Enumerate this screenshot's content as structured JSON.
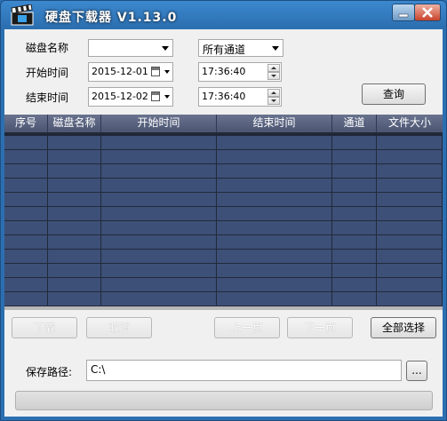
{
  "window": {
    "title": "硬盘下载器 V1.13.0",
    "title_color": "#ffffff",
    "frame_color": "#2c6fb0"
  },
  "titlebar_buttons": {
    "minimize": "minimize-icon",
    "close": "close-icon"
  },
  "filters": {
    "disk_label": "磁盘名称",
    "disk_value": "",
    "channel_value": "所有通道",
    "start_label": "开始时间",
    "start_date": "2015-12-01",
    "start_time": "17:36:40",
    "end_label": "结束时间",
    "end_date": "2015-12-02",
    "end_time": "17:36:40",
    "query_button": "查询"
  },
  "table": {
    "columns": [
      "序号",
      "磁盘名称",
      "开始时间",
      "结束时间",
      "通道",
      "文件大小"
    ],
    "header_color": "#5a6480",
    "row_color": "#3d5078",
    "row_count": 12,
    "rows": []
  },
  "actions": {
    "download": "下载",
    "cancel": "取消",
    "prev_page": "上一页",
    "next_page": "下一页",
    "select_all": "全部选择"
  },
  "save": {
    "label": "保存路径:",
    "path": "C:\\",
    "browse": "..."
  },
  "progress": {
    "value": 0
  }
}
